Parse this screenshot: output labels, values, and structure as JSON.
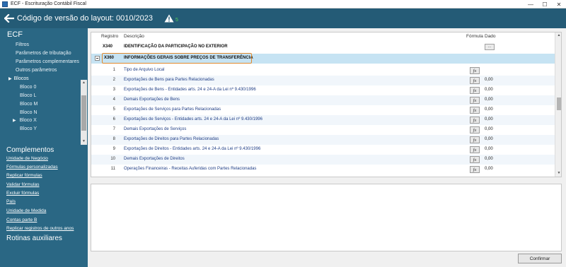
{
  "window": {
    "title": "ECF - Escrituração Contábil Fiscal",
    "controls": [
      "—",
      "☐",
      "✕"
    ]
  },
  "header": {
    "layout_title": "Código de versão do layout: 0010/2023",
    "warning_label": "5"
  },
  "sidebar": {
    "title": "ECF",
    "items": [
      "Filtros",
      "Parâmetros de tributação",
      "Parâmetros complementares",
      "Outros parâmetros"
    ],
    "blocos_label": "Blocos",
    "blocos": [
      "Bloco 0",
      "Bloco L",
      "Bloco M",
      "Bloco N",
      "Bloco X",
      "Bloco Y"
    ],
    "complementos_title": "Complementos",
    "complementos": [
      "Unidade de Negócio",
      "Fórmulas personalizadas",
      "Replicar fórmulas",
      "Validar fórmulas",
      "Excluir fórmulas",
      "País",
      "Unidade de Medida",
      "Contas parte B",
      "Replicar registros de outros anos"
    ],
    "rotinas_title": "Rotinas auxiliares"
  },
  "grid": {
    "columns": {
      "registro": "Registro",
      "descricao": "Descrição",
      "formula": "Fórmula",
      "dado": "Dado"
    },
    "rows": [
      {
        "reg": "X340",
        "desc": "IDENTIFICAÇÃO DA PARTICIPAÇÃO NO EXTERIOR",
        "bold": true,
        "has_fx": false,
        "dado": "",
        "dots": "..."
      },
      {
        "reg": "X360",
        "desc": "INFORMAÇÕES GERAIS SOBRE PREÇOS DE TRANSFERÊNCIA",
        "bold": true,
        "selected": true,
        "has_fx": false,
        "dado": ""
      },
      {
        "num": "1",
        "desc": "Tipo de Arquivo Local",
        "has_fx": true,
        "dado": ""
      },
      {
        "num": "2",
        "desc": "Exportações de Bens para Partes Relacionadas",
        "has_fx": true,
        "dado": "0,00"
      },
      {
        "num": "3",
        "desc": "Exportações de Bens - Entidades arts. 24 e 24-A da Lei nº 9.430/1996",
        "has_fx": true,
        "dado": "0,00"
      },
      {
        "num": "4",
        "desc": "Demais Exportações de Bens",
        "has_fx": true,
        "dado": "0,00"
      },
      {
        "num": "5",
        "desc": "Exportações de Serviços para Partes Relacionadas",
        "has_fx": true,
        "dado": "0,00"
      },
      {
        "num": "6",
        "desc": "Exportações de Serviços - Entidades arts. 24 e 24-A da Lei nº 9.430/1996",
        "has_fx": true,
        "dado": "0,00"
      },
      {
        "num": "7",
        "desc": "Demais Exportações de Serviços",
        "has_fx": true,
        "dado": "0,00"
      },
      {
        "num": "8",
        "desc": "Exportações de Direitos para Partes Relacionadas",
        "has_fx": true,
        "dado": "0,00"
      },
      {
        "num": "9",
        "desc": "Exportações de Direitos - Entidades arts. 24 e 24-A da Lei nº 9.430/1996",
        "has_fx": true,
        "dado": "0,00"
      },
      {
        "num": "10",
        "desc": "Demais Exportações de Direitos",
        "has_fx": true,
        "dado": "0,00"
      },
      {
        "num": "11",
        "desc": "Operações Financeiras - Receitas Auferidas com Partes Relacionadas",
        "has_fx": true,
        "dado": "0,00"
      }
    ],
    "fx_label": "fx"
  },
  "footer": {
    "confirm_label": "Confirmar"
  },
  "colors": {
    "header_bg": "#245b76",
    "sidebar_bg": "#2a6784",
    "highlight_border": "#e08a2e",
    "selected_row": "#c6e3f3"
  }
}
